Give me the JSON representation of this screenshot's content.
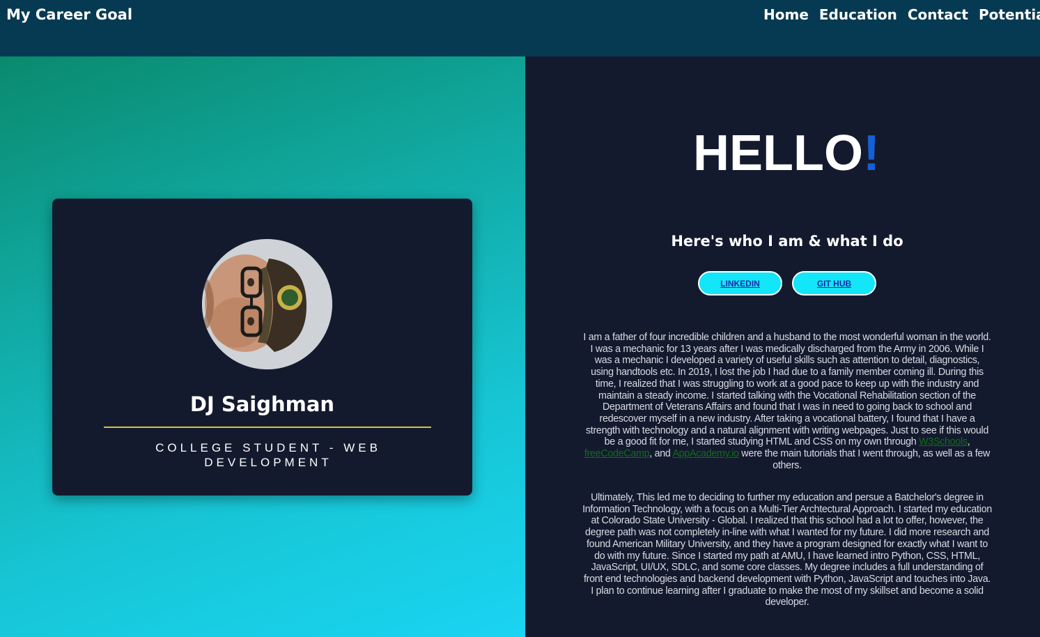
{
  "header": {
    "brand": "My Career Goal",
    "nav": [
      "Home",
      "Education",
      "Contact",
      "Potentia"
    ]
  },
  "profile_card": {
    "avatar_alt": "profile photo",
    "name": "DJ Saighman",
    "role": "COLLEGE STUDENT - WEB DEVELOPMENT"
  },
  "intro": {
    "hello": "HELLO",
    "hello_punct": "!",
    "subtitle": "Here's who I am & what I do",
    "buttons": {
      "linkedin": "LINKEDIN",
      "github": "GIT HUB"
    }
  },
  "bio": {
    "p1_a": "I am a father of four incredible children and a husband to the most wonderful woman in the world. I was a mechanic for 13 years after I was medically discharged from the Army in 2006. While I was a mechanic I developed a variety of useful skills such as attention to detail, diagnostics, using handtools etc. In 2019, I lost the job I had due to a family member coming ill. During this time, I realized that I was struggling to work at a good pace to keep up with the industry and maintain a steady income. I started talking with the Vocational Rehabilitation section of the Department of Veterans Affairs and found that I was in need to going back to school and redescover myself in a new industry. After taking a vocational battery, I found that I have a strength with technology and a natural alignment with writing webpages. Just to see if this would be a good fit for me, I started studying HTML and CSS on my own through ",
    "link_w3": "W3Schools",
    "sep_1": ", ",
    "link_fcc": "freeCodeCamp",
    "sep_2": ", and ",
    "link_aa": "AppAcademy.io",
    "p1_b": " were the main tutorials that I went through, as well as a few others.",
    "p2": "Ultimately, This led me to deciding to further my education and persue a Batchelor's degree in Information Technology, with a focus on a Multi-Tier Archtectural Approach. I started my education at Colorado State University - Global. I realized that this school had a lot to offer, however, the degree path was not completely in-line with what I wanted for my future. I did more research and found American Military University, and they have a program designed for exactly what I want to do with my future. Since I started my path at AMU, I have learned intro Python, CSS, HTML, JavaScript, UI/UX, SDLC, and some core classes. My degree includes a full understanding of front end technologies and backend development with Python, JavaScript and touches into Java. I plan to continue learning after I graduate to make the most of my skillset and become a solid developer."
  },
  "colors": {
    "header_bg": "#063a52",
    "panel_bg": "#141a2e",
    "accent_rule": "#d8c23a",
    "button_bg": "#12e6f8",
    "exclamation": "#1560d8",
    "link": "#0f6d18"
  }
}
